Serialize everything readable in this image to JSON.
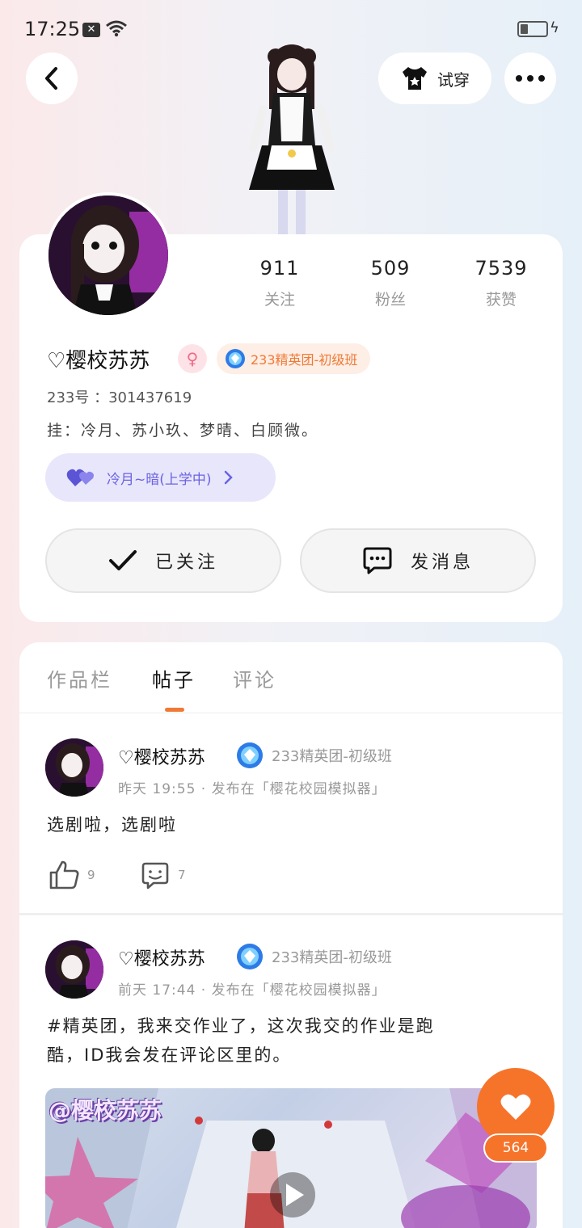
{
  "status_bar": {
    "time": "17:25"
  },
  "header": {
    "try_on_label": "试穿"
  },
  "profile": {
    "stats": [
      {
        "value": "911",
        "label": "关注"
      },
      {
        "value": "509",
        "label": "粉丝"
      },
      {
        "value": "7539",
        "label": "获赞"
      }
    ],
    "username": "♡樱校苏苏",
    "gender_symbol": "♀",
    "badge": "233精英团-初级班",
    "uid": "233号 ：301437619",
    "bio": "挂：冷月、苏小玖、梦晴、白顾微。",
    "couple": "冷月~暗(上学中)",
    "follow_label": "已关注",
    "message_label": "发消息"
  },
  "tabs": [
    {
      "label": "作品栏",
      "active": false
    },
    {
      "label": "帖子",
      "active": true
    },
    {
      "label": "评论",
      "active": false
    }
  ],
  "posts": [
    {
      "author": "♡樱校苏苏",
      "badge": "233精英团-初级班",
      "meta": "昨天 19:55 · 发布在「樱花校园模拟器」",
      "text": "选剧啦，选剧啦",
      "likes": "9",
      "comments": "7"
    },
    {
      "author": "♡樱校苏苏",
      "badge": "233精英团-初级班",
      "meta": "前天 17:44 · 发布在「樱花校园模拟器」",
      "text_line1": "#精英团，我来交作业了，这次我交的作业是跑",
      "text_line2": "酷，ID我会发在评论区里的。",
      "video_watermark": "@樱校苏苏"
    }
  ],
  "fab": {
    "count": "564"
  },
  "colors": {
    "accent": "#f6742a",
    "purple": "#6b63e0"
  }
}
